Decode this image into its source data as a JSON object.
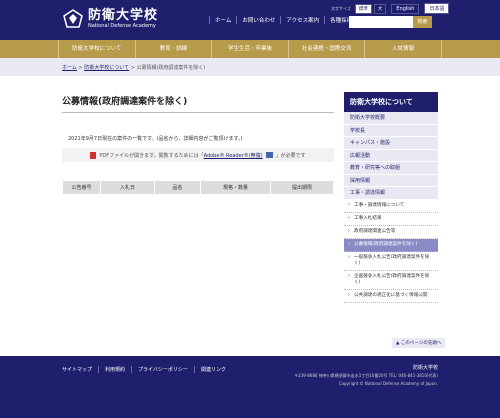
{
  "header": {
    "logo_ja": "防衛大学校",
    "logo_en": "National Defense Academy",
    "font_size_label": "文字サイズ",
    "font_sizes": [
      "標準",
      "大"
    ],
    "languages": [
      "English",
      "日本語"
    ],
    "links": [
      "ホーム",
      "お問い合わせ",
      "アクセス案内",
      "各種採用"
    ],
    "search_placeholder": "",
    "search_button": "検索"
  },
  "gnav": [
    "防衛大学校について",
    "教育・訓練",
    "学生生活・卒業後",
    "社会連携・国際交流",
    "入試情報"
  ],
  "breadcrumb": {
    "home": "ホーム",
    "parent": "防衛大学校について",
    "current": "公募情報(政府調達案件を除く)"
  },
  "main": {
    "title": "公募情報(政府調達案件を除く)",
    "intro": "2021年9月7日現在の案件の一覧です。(品名から、詳細内容がご覧頂けます。)",
    "pdf_note_pre": "PDFファイルが開きます。閲覧するためには「",
    "pdf_link": "Adobe® Reader®(無償)",
    "pdf_note_post": "」が必要です",
    "table_headers": [
      "公告番号",
      "入札日",
      "品名",
      "規格・数量",
      "提出期限"
    ]
  },
  "sidebar": {
    "heading": "防衛大学校について",
    "items": [
      "防衛大学校概要",
      "学校長",
      "キャンパス・施設",
      "広報活動",
      "教育・研究等への取組",
      "採用情報",
      "工事・調達情報"
    ],
    "sub_items": [
      "工事・調達情報について",
      "工事入札結果",
      "政府調達関連公告等",
      "公募情報(政府調達案件を除く)",
      "一般競争入札公告(政府調達案件を除く)",
      "企画競争入札公告(政府調達案件を除く)",
      "公共調達の適正化に基づく情報公開"
    ],
    "pagetop": "このページの先頭へ"
  },
  "footer": {
    "links": [
      "サイトマップ",
      "利用規約",
      "プライバシーポリシー",
      "関連リンク"
    ],
    "name": "防衛大学校",
    "address": "〒239-8686 神奈川県横須賀市走水1丁目10番20号 TEL: 046-841-3810(代表)",
    "copyright": "Copyright © National Defense Academy of Japan."
  },
  "colors": {
    "navy": "#1f1f6e",
    "gold": "#b79a4a",
    "light": "#e9e9f3"
  }
}
